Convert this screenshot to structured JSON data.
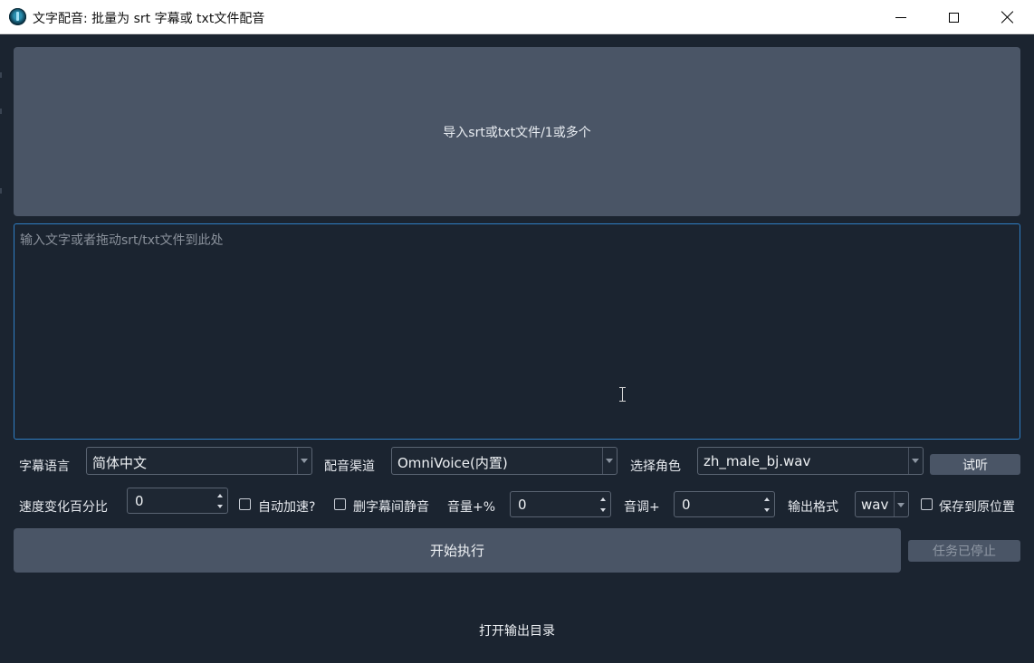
{
  "window": {
    "title": "文字配音: 批量为 srt 字幕或 txt文件配音",
    "icon": "app-logo-icon",
    "controls": [
      "minimize-icon",
      "maximize-icon",
      "close-icon"
    ]
  },
  "import_button": {
    "label": "导入srt或txt文件/1或多个"
  },
  "text_input": {
    "placeholder": "输入文字或者拖动srt/txt文件到此处",
    "value": ""
  },
  "row1": {
    "subtitle_lang_label": "字幕语言",
    "subtitle_lang_value": "简体中文",
    "channel_label": "配音渠道",
    "channel_value": "OmniVoice(内置)",
    "role_label": "选择角色",
    "role_value": "zh_male_bj.wav",
    "listen_button": "试听"
  },
  "row2": {
    "speed_label": "速度变化百分比",
    "speed_value": "0",
    "auto_speed_label": "自动加速?",
    "auto_speed_checked": false,
    "remove_silence_label": "删字幕间静音",
    "remove_silence_checked": false,
    "volume_label": "音量+%",
    "volume_value": "0",
    "pitch_label": "音调+",
    "pitch_value": "0",
    "format_label": "输出格式",
    "format_value": "wav",
    "save_original_label": "保存到原位置",
    "save_original_checked": false
  },
  "actions": {
    "start_button": "开始执行",
    "status_button": "任务已停止",
    "open_output": "打开输出目录"
  },
  "colors": {
    "background": "#1b2430",
    "button": "#4a5566",
    "focus_border": "#2f7fc4",
    "titlebar": "#ffffff"
  }
}
